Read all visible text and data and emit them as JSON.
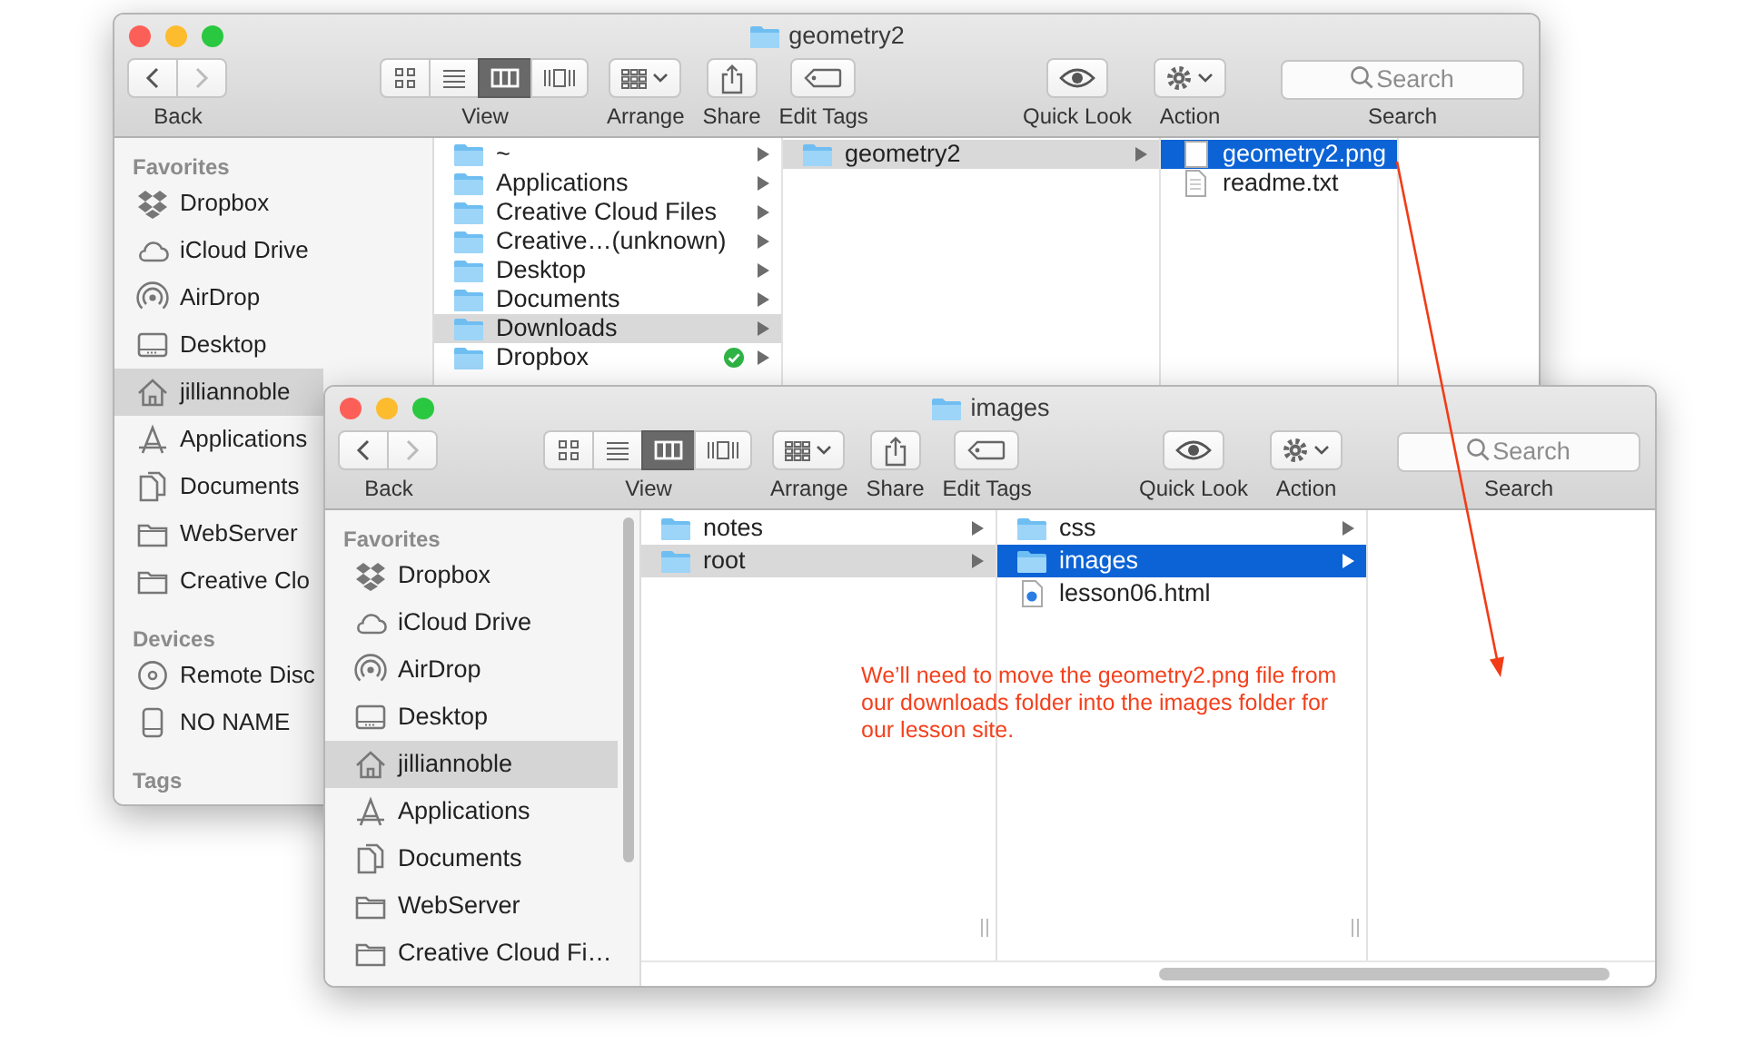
{
  "windows": [
    {
      "title": "geometry2",
      "toolbar": {
        "back_enabled": true,
        "forward_enabled": false,
        "back": "Back",
        "view": "View",
        "view_modes": [
          {
            "kind": "icons",
            "selected": false
          },
          {
            "kind": "list",
            "selected": false
          },
          {
            "kind": "columns",
            "selected": true
          },
          {
            "kind": "gallery",
            "selected": false
          }
        ],
        "arrange": "Arrange",
        "share": "Share",
        "edit_tags": "Edit Tags",
        "quick_look": "Quick Look",
        "action": "Action",
        "search_placeholder": "Search",
        "search": "Search"
      },
      "sidebar": [
        {
          "heading": "Favorites",
          "items": [
            {
              "label": "Dropbox",
              "kind": "dropbox",
              "selected": false
            },
            {
              "label": "iCloud Drive",
              "kind": "cloud",
              "selected": false
            },
            {
              "label": "AirDrop",
              "kind": "airdrop",
              "selected": false
            },
            {
              "label": "Desktop",
              "kind": "desktop",
              "selected": false
            },
            {
              "label": "jilliannoble",
              "kind": "home",
              "selected": true
            },
            {
              "label": "Applications",
              "kind": "apps",
              "selected": false
            },
            {
              "label": "Documents",
              "kind": "documents",
              "selected": false
            },
            {
              "label": "WebServer",
              "kind": "folder",
              "selected": false
            },
            {
              "label": "Creative Clo",
              "kind": "folder",
              "selected": false
            }
          ]
        },
        {
          "heading": "Devices",
          "items": [
            {
              "label": "Remote Disc",
              "kind": "disc",
              "selected": false
            },
            {
              "label": "NO NAME",
              "kind": "drive",
              "selected": false
            }
          ]
        },
        {
          "heading": "Tags"
        }
      ],
      "columns": [
        {
          "active": false,
          "items": [
            {
              "name": "~",
              "kind": "folder",
              "selected": false,
              "synced": false
            },
            {
              "name": "Applications",
              "kind": "folder",
              "selected": false,
              "synced": false
            },
            {
              "name": "Creative Cloud Files",
              "kind": "folder",
              "selected": false,
              "synced": false
            },
            {
              "name": "Creative…(unknown)",
              "kind": "folder",
              "selected": false,
              "synced": false
            },
            {
              "name": "Desktop",
              "kind": "folder",
              "selected": false,
              "synced": false
            },
            {
              "name": "Documents",
              "kind": "folder",
              "selected": false,
              "synced": false
            },
            {
              "name": "Downloads",
              "kind": "folder",
              "selected": true,
              "synced": false
            },
            {
              "name": "Dropbox",
              "kind": "folder",
              "selected": false,
              "synced": true
            }
          ]
        },
        {
          "active": false,
          "items": [
            {
              "name": "geometry2",
              "kind": "folder",
              "selected": true
            }
          ]
        },
        {
          "active": true,
          "items": [
            {
              "name": "geometry2.png",
              "kind": "image",
              "selected": true
            },
            {
              "name": "readme.txt",
              "kind": "text",
              "selected": false
            }
          ]
        }
      ]
    },
    {
      "title": "images",
      "toolbar": {
        "back_enabled": true,
        "forward_enabled": false,
        "back": "Back",
        "view": "View",
        "view_modes": [
          {
            "kind": "icons",
            "selected": false
          },
          {
            "kind": "list",
            "selected": false
          },
          {
            "kind": "columns",
            "selected": true
          },
          {
            "kind": "gallery",
            "selected": false
          }
        ],
        "arrange": "Arrange",
        "share": "Share",
        "edit_tags": "Edit Tags",
        "quick_look": "Quick Look",
        "action": "Action",
        "search_placeholder": "Search",
        "search": "Search"
      },
      "sidebar": [
        {
          "heading": "Favorites",
          "items": [
            {
              "label": "Dropbox",
              "kind": "dropbox",
              "selected": false
            },
            {
              "label": "iCloud Drive",
              "kind": "cloud",
              "selected": false
            },
            {
              "label": "AirDrop",
              "kind": "airdrop",
              "selected": false
            },
            {
              "label": "Desktop",
              "kind": "desktop",
              "selected": false
            },
            {
              "label": "jilliannoble",
              "kind": "home",
              "selected": true
            },
            {
              "label": "Applications",
              "kind": "apps",
              "selected": false
            },
            {
              "label": "Documents",
              "kind": "documents",
              "selected": false
            },
            {
              "label": "WebServer",
              "kind": "folder",
              "selected": false
            },
            {
              "label": "Creative Cloud Fi…",
              "kind": "folder",
              "selected": false
            }
          ]
        }
      ],
      "columns": [
        {
          "active": false,
          "items": [
            {
              "name": "notes",
              "kind": "folder",
              "selected": false
            },
            {
              "name": "root",
              "kind": "folder",
              "selected": true
            }
          ]
        },
        {
          "active": true,
          "items": [
            {
              "name": "css",
              "kind": "folder",
              "selected": false
            },
            {
              "name": "images",
              "kind": "folder",
              "selected": true
            },
            {
              "name": "lesson06.html",
              "kind": "html",
              "selected": false
            }
          ]
        }
      ]
    }
  ],
  "annotation": {
    "text": "We’ll need to move the geometry2.png file from our downloads folder into the images folder for our lesson site."
  }
}
